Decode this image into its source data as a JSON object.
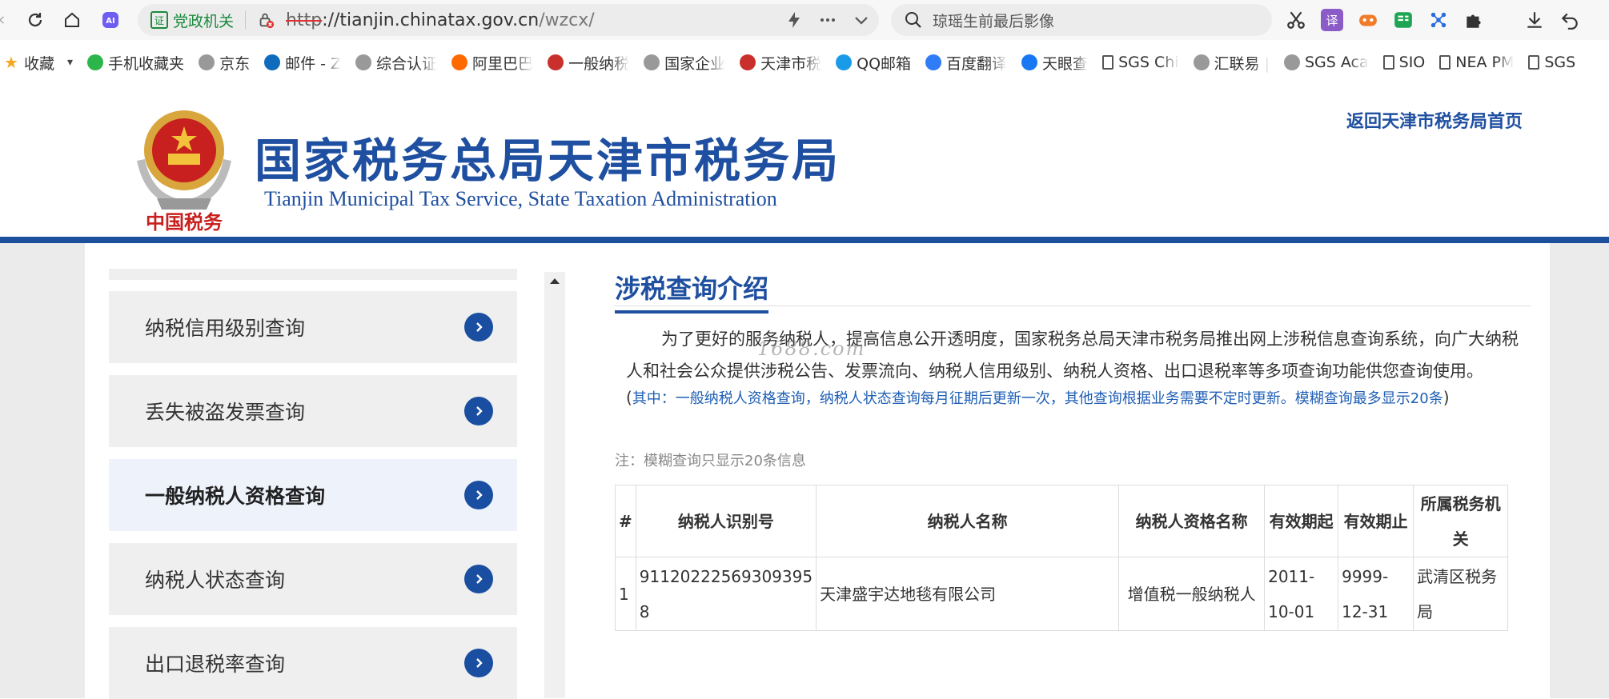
{
  "browser": {
    "address": {
      "cert_label": "党政机关",
      "url_protocol": "http",
      "url_host": "://tianjin.chinatax.gov.cn",
      "url_path": "/wzcx/"
    },
    "search": {
      "placeholder": "琼瑶生前最后影像"
    },
    "extensions": [
      {
        "name": "scissors-icon"
      },
      {
        "name": "translate-icon",
        "label": "译",
        "color": "#8b5cc7"
      },
      {
        "name": "game-icon",
        "color": "#f07c2a"
      },
      {
        "name": "reader-icon",
        "color": "#1ea553"
      },
      {
        "name": "network-icon",
        "color": "#2a6be0"
      },
      {
        "name": "puzzle-icon"
      },
      {
        "name": "download-icon"
      },
      {
        "name": "undo-icon"
      }
    ],
    "bookmarks": [
      {
        "label": "收藏",
        "icon": "star-icon",
        "color": "#f5a623",
        "full": true
      },
      {
        "label": "手机收藏夹",
        "icon": "phone-icon",
        "color": "#2bb54a",
        "full": true
      },
      {
        "label": "京东",
        "icon": "globe-icon",
        "color": "#999",
        "full": true
      },
      {
        "label": "邮件 - Z",
        "icon": "outlook-icon",
        "color": "#0f6cbd"
      },
      {
        "label": "综合认证",
        "icon": "globe-icon",
        "color": "#999"
      },
      {
        "label": "阿里巴巴",
        "icon": "alibaba-icon",
        "color": "#ff6a00"
      },
      {
        "label": "一般纳税",
        "icon": "tax-icon",
        "color": "#c9302c"
      },
      {
        "label": "国家企业",
        "icon": "globe-icon",
        "color": "#999"
      },
      {
        "label": "天津市税",
        "icon": "tax-icon",
        "color": "#c9302c"
      },
      {
        "label": "QQ邮箱",
        "icon": "qq-icon",
        "color": "#1a9be8",
        "full": true
      },
      {
        "label": "百度翻译",
        "icon": "baidu-icon",
        "color": "#2f7cf6"
      },
      {
        "label": "天眼查",
        "icon": "tianyan-icon",
        "color": "#1877f2"
      },
      {
        "label": "SGS Chi",
        "icon": "doc-icon",
        "color": "#666"
      },
      {
        "label": "汇联易 |",
        "icon": "globe-icon",
        "color": "#999"
      },
      {
        "label": "SGS Aca",
        "icon": "globe-icon",
        "color": "#999"
      },
      {
        "label": "SIO",
        "icon": "doc-icon",
        "color": "#666",
        "full": true
      },
      {
        "label": "NEA PM",
        "icon": "doc-icon",
        "color": "#666"
      },
      {
        "label": "SGS",
        "icon": "doc-icon",
        "color": "#666",
        "full": true
      }
    ]
  },
  "header": {
    "emblem_text": "中国税务",
    "title": "国家税务总局天津市税务局",
    "subtitle": "Tianjin Municipal Tax Service, State Taxation Administration",
    "home_link": "返回天津市税务局首页"
  },
  "sidebar": {
    "items": [
      {
        "label": "纳税信用级别查询",
        "active": false
      },
      {
        "label": "丢失被盗发票查询",
        "active": false
      },
      {
        "label": "一般纳税人资格查询",
        "active": true
      },
      {
        "label": "纳税人状态查询",
        "active": false
      },
      {
        "label": "出口退税率查询",
        "active": false
      }
    ]
  },
  "main": {
    "section_title": "涉税查询介绍",
    "intro": "为了更好的服务纳税人，提高信息公开透明度，国家税务总局天津市税务局推出网上涉税信息查询系统，向广大纳税人和社会公众提供涉税公告、发票流向、纳税人信用级别、纳税人资格、出口退税率等多项查询功能供您查询使用。",
    "watermark": "1688.com",
    "note_blue": "其中：一般纳税人资格查询，纳税人状态查询每月征期后更新一次，其他查询根据业务需要不定时更新。模糊查询最多显示20条",
    "note_gray": "注：模糊查询只显示20条信息",
    "table": {
      "headers": [
        "#",
        "纳税人识别号",
        "纳税人名称",
        "纳税人资格名称",
        "有效期起",
        "有效期止",
        "所属税务机关"
      ],
      "rows": [
        [
          "1",
          "91120222569309395​8",
          "天津盛宇达地毯有限公司",
          "增值税一般纳税人",
          "2011-10-01",
          "9999-12-31",
          "武清区税务局"
        ]
      ]
    }
  }
}
